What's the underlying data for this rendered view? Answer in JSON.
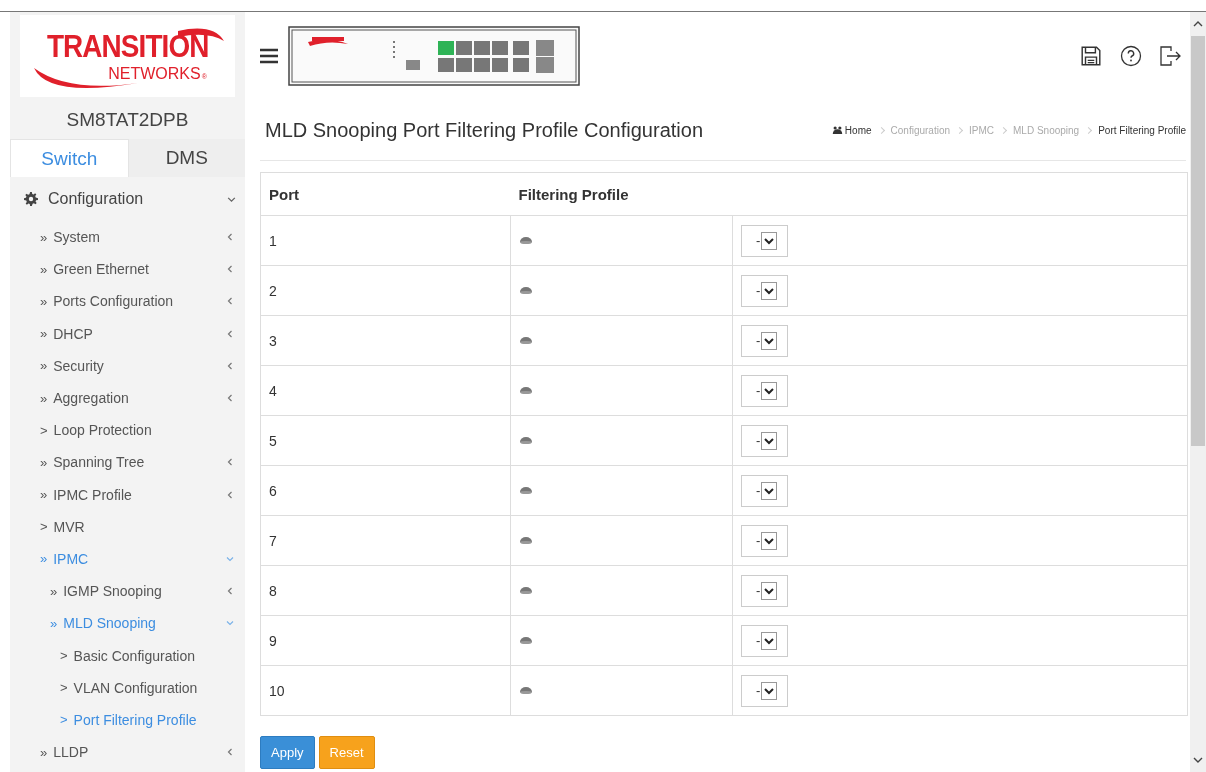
{
  "logo": {
    "brand": "TRANSITION",
    "sub": "NETWORKS",
    "mark": "®"
  },
  "sidebar": {
    "device_name": "SM8TAT2DPB",
    "tabs": [
      {
        "label": "Switch",
        "selected": true
      },
      {
        "label": "DMS",
        "selected": false
      }
    ],
    "menu": {
      "label": "Configuration",
      "expanded": true,
      "children": [
        {
          "marker": "»",
          "label": "System",
          "selected": false,
          "expanded": false
        },
        {
          "marker": "»",
          "label": "Green Ethernet",
          "selected": false,
          "expanded": false
        },
        {
          "marker": "»",
          "label": "Ports Configuration",
          "selected": false,
          "expanded": false
        },
        {
          "marker": "»",
          "label": "DHCP",
          "selected": false,
          "expanded": false
        },
        {
          "marker": "»",
          "label": "Security",
          "selected": false,
          "expanded": false
        },
        {
          "marker": "»",
          "label": "Aggregation",
          "selected": false,
          "expanded": false
        },
        {
          "marker": ">",
          "label": "Loop Protection",
          "selected": false
        },
        {
          "marker": "»",
          "label": "Spanning Tree",
          "selected": false,
          "expanded": false
        },
        {
          "marker": "»",
          "label": "IPMC Profile",
          "selected": false,
          "expanded": false
        },
        {
          "marker": ">",
          "label": "MVR",
          "selected": false
        },
        {
          "marker": "»",
          "label": "IPMC",
          "selected": true,
          "expanded": true,
          "children": [
            {
              "marker": "»",
              "label": "IGMP Snooping",
              "selected": false,
              "expanded": false
            },
            {
              "marker": "»",
              "label": "MLD Snooping",
              "selected": true,
              "expanded": true,
              "children": [
                {
                  "marker": ">",
                  "label": "Basic Configuration",
                  "selected": false
                },
                {
                  "marker": ">",
                  "label": "VLAN Configuration",
                  "selected": false
                },
                {
                  "marker": ">",
                  "label": "Port Filtering Profile",
                  "selected": true
                }
              ]
            }
          ]
        },
        {
          "marker": "»",
          "label": "LLDP",
          "selected": false,
          "expanded": false
        }
      ]
    }
  },
  "page": {
    "title": "MLD Snooping Port Filtering Profile Configuration",
    "breadcrumb": [
      {
        "label": "Home",
        "kind": "home"
      },
      {
        "label": "Configuration",
        "kind": "link"
      },
      {
        "label": "IPMC",
        "kind": "link"
      },
      {
        "label": "MLD Snooping",
        "kind": "link"
      },
      {
        "label": "Port Filtering Profile",
        "kind": "current"
      }
    ],
    "table": {
      "columns": [
        "Port",
        "Filtering Profile"
      ],
      "rows": [
        {
          "port": "1",
          "profile": "-"
        },
        {
          "port": "2",
          "profile": "-"
        },
        {
          "port": "3",
          "profile": "-"
        },
        {
          "port": "4",
          "profile": "-"
        },
        {
          "port": "5",
          "profile": "-"
        },
        {
          "port": "6",
          "profile": "-"
        },
        {
          "port": "7",
          "profile": "-"
        },
        {
          "port": "8",
          "profile": "-"
        },
        {
          "port": "9",
          "profile": "-"
        },
        {
          "port": "10",
          "profile": "-"
        }
      ]
    },
    "buttons": [
      {
        "label": "Apply",
        "kind": "primary"
      },
      {
        "label": "Reset",
        "kind": "warning"
      }
    ]
  }
}
